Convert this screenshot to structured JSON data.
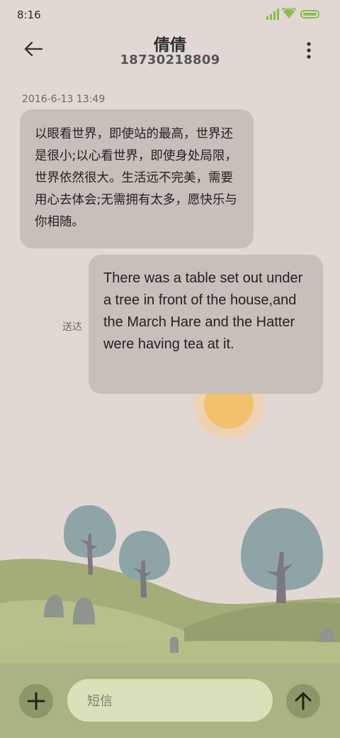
{
  "status_bar": {
    "time": "8:16"
  },
  "header": {
    "contact_name": "倩倩",
    "phone_number": "18730218809"
  },
  "messages": [
    {
      "direction": "incoming",
      "timestamp": "2016-6-13 13:49",
      "text": "以眼看世界，即使站的最高，世界还是很小;以心看世界，即使身处局限，世界依然很大。生活远不完美，需要用心去体会;无需拥有太多，愿快乐与你相随。"
    },
    {
      "direction": "outgoing",
      "status": "送达",
      "text": "There was a table set out under a tree in front of the house,and the March Hare and the Hatter were having tea at it."
    }
  ],
  "composer": {
    "placeholder": "短信"
  },
  "icons": {
    "back": "arrow-left-icon",
    "more": "more-vert-icon",
    "add": "plus-icon",
    "send": "arrow-up-icon",
    "signal": "signal-icon",
    "wifi": "wifi-icon",
    "battery": "battery-icon"
  },
  "colors": {
    "background": "#e1d8d4",
    "bubble": "#c8bfbb",
    "composer_bar": "#aab382",
    "accent": "#8bbd4c",
    "sun": "#f2c16e"
  }
}
